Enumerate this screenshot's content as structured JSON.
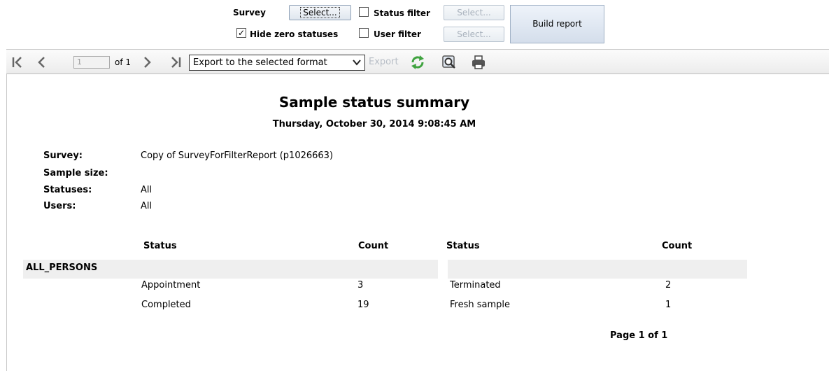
{
  "filters": {
    "survey_label": "Survey",
    "survey_button": "Select...",
    "status_filter_label": "Status filter",
    "status_filter_button": "Select...",
    "hide_zero_label": "Hide zero statuses",
    "hide_zero_checked": "✓",
    "user_filter_label": "User filter",
    "user_filter_button": "Select...",
    "build_button": "Build report"
  },
  "toolbar": {
    "page_value": "1",
    "page_of": "of 1",
    "export_format": "Export to the selected format",
    "export_link": "Export"
  },
  "report": {
    "title": "Sample status summary",
    "date": "Thursday, October 30, 2014 9:08:45 AM",
    "info": [
      {
        "key": "Survey:",
        "value": "Copy of SurveyForFilterReport (p1026663)"
      },
      {
        "key": "Sample size:",
        "value": ""
      },
      {
        "key": "Statuses:",
        "value": "All"
      },
      {
        "key": "Users:",
        "value": "All"
      }
    ],
    "headers": {
      "status_left": "Status",
      "count_left": "Count",
      "status_right": "Status",
      "count_right": "Count"
    },
    "group": "ALL_PERSONS",
    "rows": [
      {
        "status_left": "Appointment",
        "count_left": "3",
        "status_right": "Terminated",
        "count_right": "2"
      },
      {
        "status_left": "Completed",
        "count_left": "19",
        "status_right": "Fresh sample",
        "count_right": "1"
      }
    ],
    "footer": "Page 1 of 1"
  },
  "colors": {
    "refresh_icon": "#3fa33f",
    "band": "#efefef",
    "button_border": "#8ea0b6"
  },
  "icons": [
    "first-page-icon",
    "prev-page-icon",
    "next-page-icon",
    "last-page-icon",
    "refresh-icon",
    "zoom-icon",
    "print-icon",
    "chevron-down-icon"
  ]
}
